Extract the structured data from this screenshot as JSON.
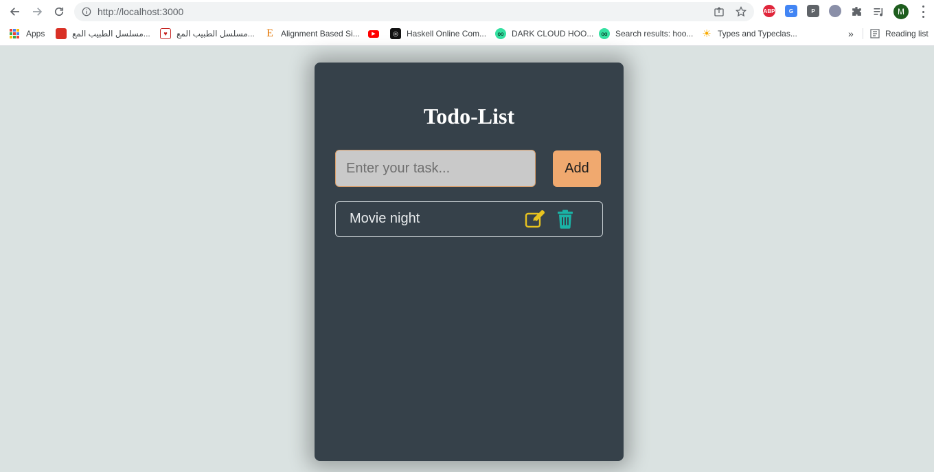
{
  "browser": {
    "url_host": "http://localhost",
    "url_port": ":3000",
    "extensions": [
      "ABP"
    ],
    "profile_initial": "M",
    "bookmarks": [
      {
        "label": "Apps",
        "icon": "apps-grid-icon"
      },
      {
        "label": "مسلسل الطبيب المع...",
        "icon": "red-bookmark-icon"
      },
      {
        "label": "مسلسل الطبيب المع...",
        "icon": "heart-bookmark-icon"
      },
      {
        "label": "Alignment Based Si...",
        "icon": "letter-e-icon"
      },
      {
        "label": "",
        "icon": "youtube-icon"
      },
      {
        "label": "Haskell Online Com...",
        "icon": "haskell-icon"
      },
      {
        "label": "DARK CLOUD HOO...",
        "icon": "tripadvisor-icon"
      },
      {
        "label": "Search results: hoo...",
        "icon": "tripadvisor-icon"
      },
      {
        "label": "Types and Typeclas...",
        "icon": "sun-icon"
      }
    ],
    "overflow_label": "»",
    "reading_list_label": "Reading list"
  },
  "app": {
    "title": "Todo-List",
    "input_placeholder": "Enter your task...",
    "input_value": "",
    "add_label": "Add",
    "todos": [
      {
        "text": "Movie night"
      }
    ]
  },
  "colors": {
    "page_bg": "#dae2e1",
    "card_bg": "#36414a",
    "accent": "#f0a96f",
    "edit_icon": "#e8c31f",
    "delete_icon": "#1ab3a6"
  }
}
